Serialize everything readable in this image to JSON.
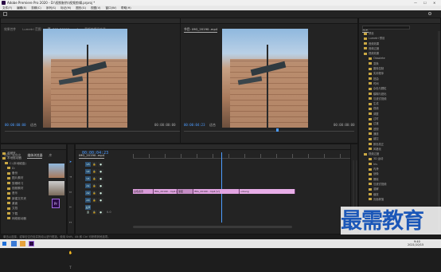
{
  "window": {
    "title": "Adobe Premiere Pro 2020 - D:\\视频制作\\视频剪辑.prproj *"
  },
  "menu": [
    "文件(F)",
    "编辑(E)",
    "剪辑(C)",
    "序列(S)",
    "标记(M)",
    "图形(G)",
    "视图(V)",
    "窗口(W)",
    "帮助(H)"
  ],
  "workspaces": [
    {
      "label": "学习",
      "active": false
    },
    {
      "label": "组件",
      "active": false
    },
    {
      "label": "编辑",
      "active": false
    },
    {
      "label": "颜色",
      "active": false
    },
    {
      "label": "效果",
      "active": true
    },
    {
      "label": "音频",
      "active": false
    },
    {
      "label": "图形",
      "active": false
    },
    {
      "label": "库",
      "active": false
    }
  ],
  "source": {
    "tabs": [
      "效果控件",
      "Lumetri 范围",
      "源: IMG_20190..mp4",
      "音频剪辑混合器"
    ],
    "tc_left": "00:00:00:00",
    "fit": "适合",
    "tc_right": "00:00:00:00"
  },
  "program": {
    "tabs": [
      "节目: IMG_20190..mp4"
    ],
    "tc_left": "00:00:04:23",
    "fit": "适合",
    "tc_right": "00:00:00:00"
  },
  "project": {
    "tabs": [
      "项目: 未命名",
      "媒体浏览器",
      "库"
    ],
    "tree": [
      "收藏夹",
      "本地驱动器",
      "C:(本地磁盘)",
      "D:",
      "备份",
      "图片素材",
      "剪辑练习",
      "视频素材",
      "音乐",
      "新建文件夹",
      "桌面",
      "文档",
      "下载",
      "网络驱动器"
    ]
  },
  "timeline": {
    "tab": "IMG_20190..mp4",
    "timecode": "00:00:04:23",
    "tracks": [
      "V3",
      "V2",
      "V1",
      "A1",
      "A2",
      "A3",
      "主声道"
    ],
    "clips": [
      {
        "label": "白色遮罩",
        "color": "#d89ad8"
      },
      {
        "label": "IMG_20190...mp4 [V]",
        "color": "#e2a4e2"
      },
      {
        "label": "渐变",
        "color": "#c48cc4"
      },
      {
        "label": "IMG_20190...mp4 [V]",
        "color": "#e2a4e2"
      },
      {
        "label": "urbang",
        "color": "#e8aee8"
      }
    ],
    "master_value": "0.0"
  },
  "effects": {
    "tab": "效果",
    "items": [
      "预设",
      "Lumetri 预设",
      "音频效果",
      "音频过渡",
      "视频效果",
      "Obsolete",
      "变换",
      "图像控制",
      "实用程序",
      "扭曲",
      "时间",
      "杂色与颗粒",
      "模糊与锐化",
      "沉浸式视频",
      "生成",
      "视频",
      "调整",
      "过时",
      "过渡",
      "透视",
      "通道",
      "键控",
      "颜色校正",
      "风格化",
      "视频过渡",
      "3D 运动",
      "Iris",
      "内滑",
      "划像",
      "擦除",
      "沉浸式视频",
      "溶解",
      "缩放",
      "页面剥落"
    ]
  },
  "status": {
    "text": "单击以选择，或单击空白处并拖动以进行框选。使用 Shift、Alt 和 Ctrl 可获得其他选项。"
  },
  "watermark": {
    "text": "最需教育"
  },
  "taskbar": {
    "time": "9:40",
    "date": "2021/10/15"
  }
}
